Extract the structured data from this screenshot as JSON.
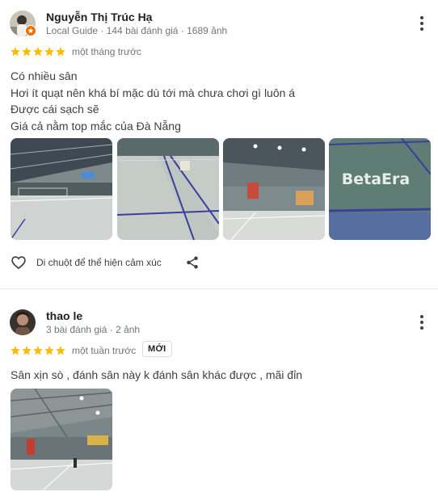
{
  "reviews": [
    {
      "name": "Nguyễn Thị Trúc Hạ",
      "meta": "Local Guide · 144 bài đánh giá · 1689 ảnh",
      "rating": 5,
      "time": "một tháng trước",
      "text_lines": [
        "Có nhiều sân",
        "Hơi ít quạt nên khá bí mặc dù tới mà chưa chơi gì luôn á",
        "Được cái sạch sẽ",
        "Giá cả nằm top mắc của Đà Nẵng"
      ],
      "photo_sign_text": "BetaEra",
      "like_hint": "Di chuột để thể hiện cảm xúc"
    },
    {
      "name": "thao le",
      "meta": "3 bài đánh giá · 2 ảnh",
      "rating": 5,
      "time": "một tuần trước",
      "badge": "MỚI",
      "text_lines": [
        "Sân xịn sò , đánh sân này k đánh sân khác được , mãi đỉn"
      ]
    }
  ],
  "colors": {
    "star": "#fbbc04",
    "court_green": "#5f7d74",
    "court_line": "#3a3f9e",
    "guide_badge": "#e8710a"
  },
  "icons": [
    "more-vert-icon",
    "star-icon",
    "heart-outline-icon",
    "share-icon",
    "local-guide-icon"
  ]
}
